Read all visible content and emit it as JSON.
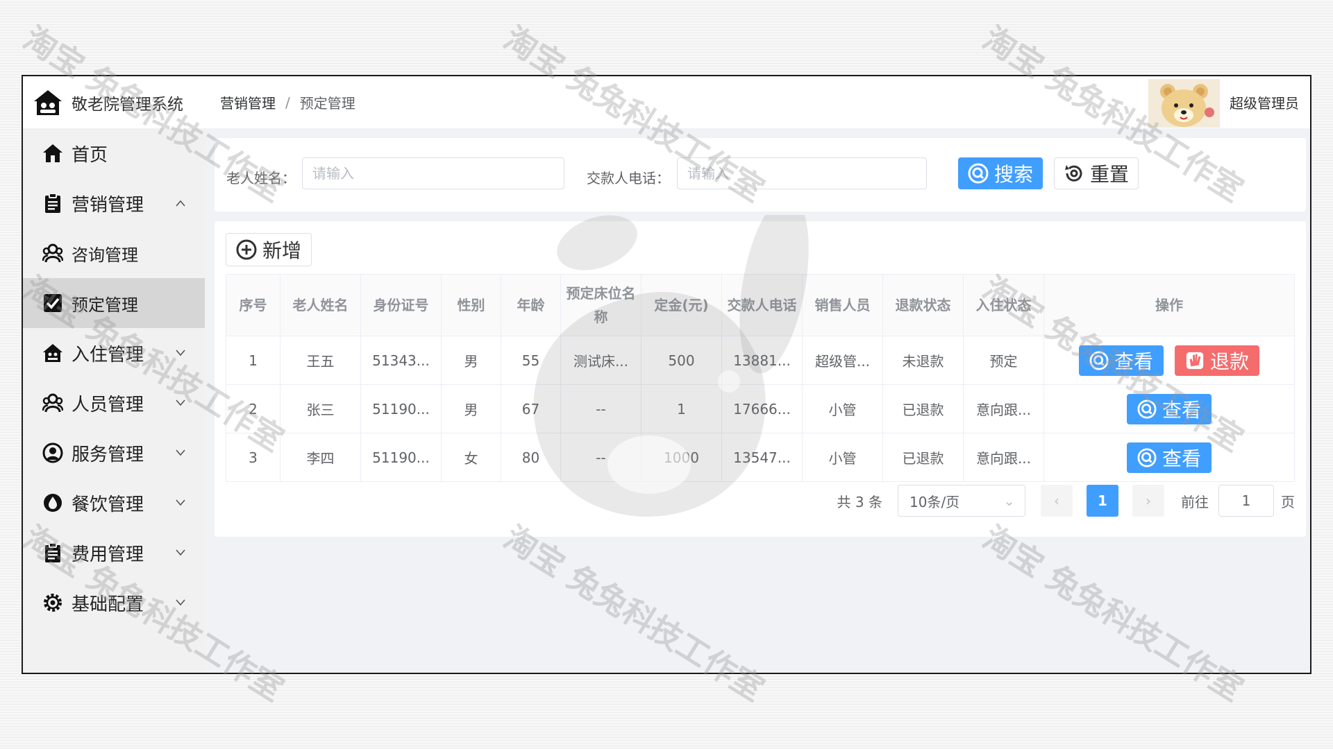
{
  "app": {
    "title": "敬老院管理系统",
    "user_name": "超级管理员",
    "colors": {
      "primary": "#409eff",
      "danger": "#f56c6c",
      "sidebar_bg": "#f1f1f1",
      "active_bg": "#d6d6d6"
    }
  },
  "sidebar": {
    "items": [
      {
        "label": "首页",
        "icon": "home-icon"
      },
      {
        "label": "营销管理",
        "icon": "clipboard-icon",
        "expanded": true
      },
      {
        "label": "咨询管理",
        "icon": "users-icon",
        "sub": true
      },
      {
        "label": "预定管理",
        "icon": "check-square-icon",
        "sub": true,
        "active": true
      },
      {
        "label": "入住管理",
        "icon": "house-icon"
      },
      {
        "label": "人员管理",
        "icon": "users-icon"
      },
      {
        "label": "服务管理",
        "icon": "service-icon"
      },
      {
        "label": "餐饮管理",
        "icon": "drop-icon"
      },
      {
        "label": "费用管理",
        "icon": "clipboard-icon"
      },
      {
        "label": "基础配置",
        "icon": "gear-icon"
      }
    ]
  },
  "breadcrumb": {
    "parent": "营销管理",
    "sep": "/",
    "current": "预定管理"
  },
  "search": {
    "name_label": "老人姓名：",
    "name_placeholder": "请输入",
    "phone_label": "交款人电话：",
    "phone_placeholder": "请输入",
    "search_label": "搜索",
    "reset_label": "重置"
  },
  "toolbar": {
    "add_label": "新增"
  },
  "table": {
    "headers": [
      "序号",
      "老人姓名",
      "身份证号",
      "性别",
      "年龄",
      "预定床位名称",
      "定金(元)",
      "交款人电话",
      "销售人员",
      "退款状态",
      "入住状态",
      "操作"
    ],
    "rows": [
      {
        "cells": [
          "1",
          "王五",
          "51343...",
          "男",
          "55",
          "测试床...",
          "500",
          "13881...",
          "超级管...",
          "未退款",
          "预定"
        ],
        "refund": true
      },
      {
        "cells": [
          "2",
          "张三",
          "51190...",
          "男",
          "67",
          "--",
          "1",
          "17666...",
          "小管",
          "已退款",
          "意向跟..."
        ],
        "refund": false
      },
      {
        "cells": [
          "3",
          "李四",
          "51190...",
          "女",
          "80",
          "--",
          "1000",
          "13547...",
          "小管",
          "已退款",
          "意向跟..."
        ],
        "refund": false
      }
    ],
    "view_label": "查看",
    "refund_label": "退款"
  },
  "pagination": {
    "total": "共 3 条",
    "page_size": "10条/页",
    "prev": "‹",
    "current_page": "1",
    "next": "›",
    "goto_label": "前往",
    "goto_value": "1",
    "page_suffix": "页"
  },
  "watermark": {
    "text": "淘宝 兔兔科技工作室"
  }
}
